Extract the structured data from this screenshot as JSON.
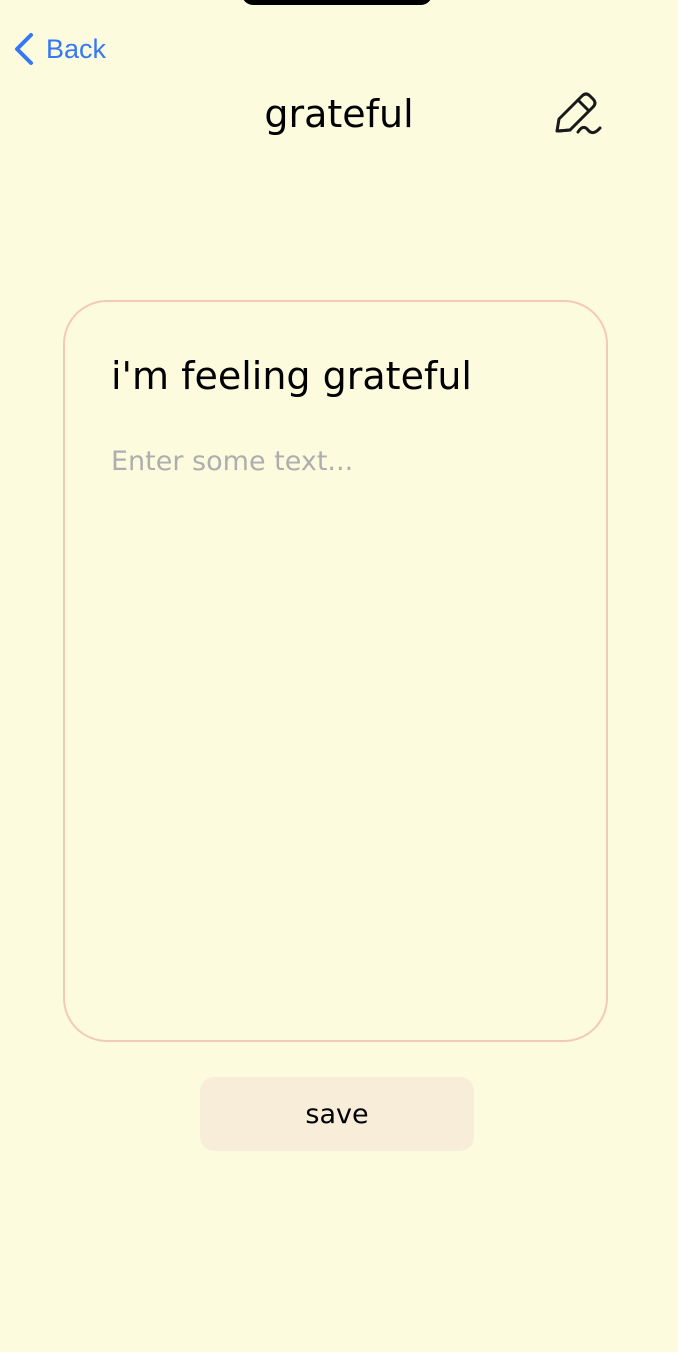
{
  "nav": {
    "back_label": "Back",
    "title": "grateful",
    "back_icon": "chevron-left-icon",
    "edit_icon": "pencil-signature-icon"
  },
  "card": {
    "heading": "i'm feeling grateful",
    "text_value": "",
    "text_placeholder": "Enter some text..."
  },
  "actions": {
    "save_label": "save"
  },
  "colors": {
    "background": "#FDFBDE",
    "accent_link": "#3478F6",
    "card_border": "#F3C9B8",
    "button_bg": "#F8EDD8",
    "placeholder": "#AEAEAE"
  }
}
